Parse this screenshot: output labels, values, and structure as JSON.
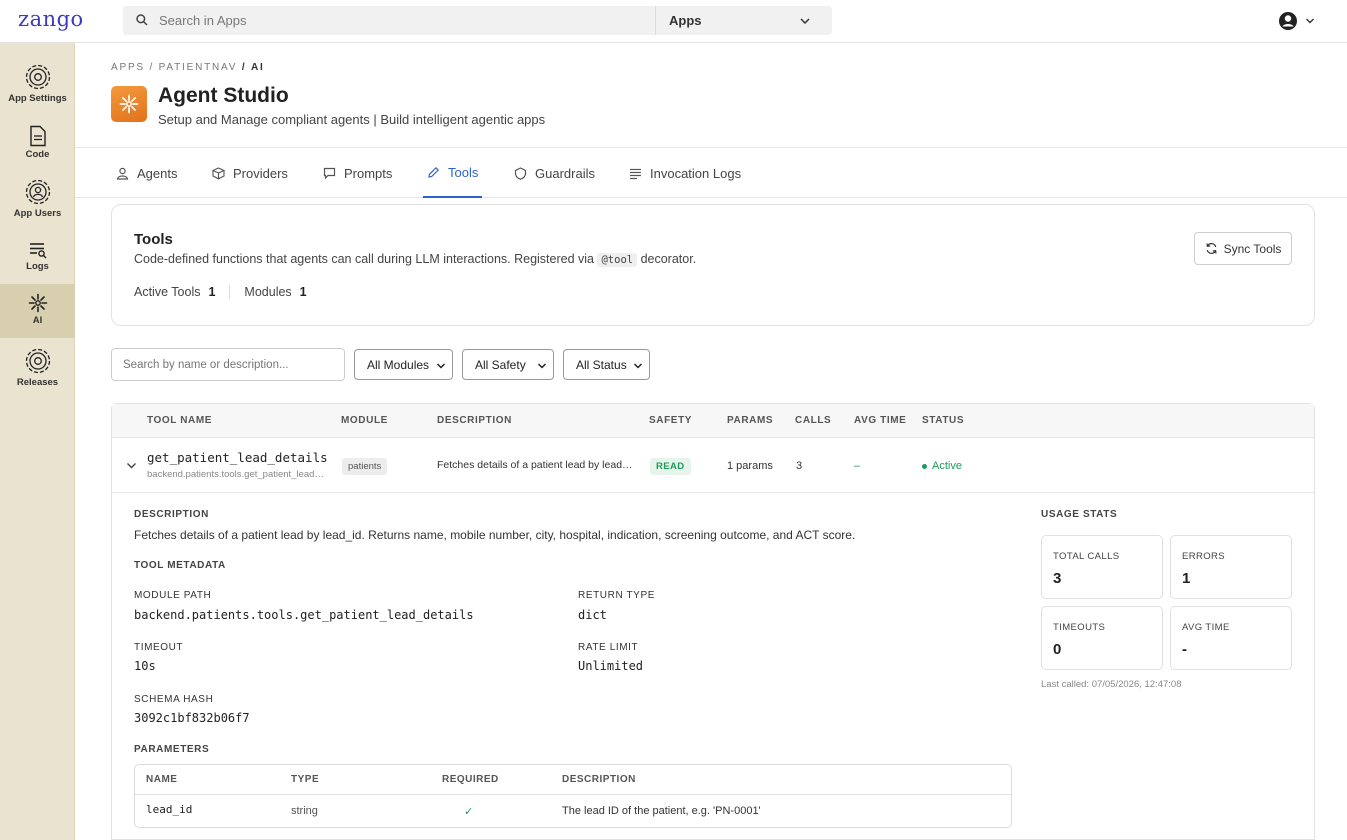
{
  "topbar": {
    "logo": "zango",
    "search_placeholder": "Search in Apps",
    "scope": "Apps"
  },
  "sidebar": {
    "items": [
      {
        "label": "App Settings",
        "icon": "gear-icon"
      },
      {
        "label": "Code",
        "icon": "file-icon"
      },
      {
        "label": "App Users",
        "icon": "users-gear-icon"
      },
      {
        "label": "Logs",
        "icon": "logs-icon"
      },
      {
        "label": "AI",
        "icon": "ai-sparkle-icon"
      },
      {
        "label": "Releases",
        "icon": "gear-icon"
      }
    ],
    "active": "AI",
    "active_color": "#d8cfae"
  },
  "breadcrumb": {
    "part1": "APPS",
    "sep": "/",
    "part2": "PATIENTNAV",
    "part3": "AI"
  },
  "header": {
    "title": "Agent Studio",
    "subtitle": "Setup and Manage compliant agents | Build intelligent agentic apps",
    "icon_color": "#e97b25"
  },
  "tabs": [
    {
      "label": "Agents",
      "icon": "person-icon"
    },
    {
      "label": "Providers",
      "icon": "cube-icon"
    },
    {
      "label": "Prompts",
      "icon": "message-icon"
    },
    {
      "label": "Tools",
      "icon": "pencil-icon"
    },
    {
      "label": "Guardrails",
      "icon": "shield-icon"
    },
    {
      "label": "Invocation Logs",
      "icon": "list-icon"
    }
  ],
  "active_tab": "Tools",
  "accent_color": "#2d63c8",
  "tools_card": {
    "title": "Tools",
    "desc_before": "Code-defined functions that agents can call during LLM interactions. Registered via",
    "desc_code": "@tool",
    "desc_after": "decorator.",
    "active_label": "Active Tools",
    "active_value": "1",
    "modules_label": "Modules",
    "modules_value": "1",
    "sync_label": "Sync Tools"
  },
  "filters": {
    "search_placeholder": "Search by name or description...",
    "modules": "All Modules",
    "safety": "All Safety",
    "status": "All Status"
  },
  "table": {
    "columns": [
      "TOOL NAME",
      "MODULE",
      "DESCRIPTION",
      "SAFETY",
      "PARAMS",
      "CALLS",
      "AVG TIME",
      "STATUS"
    ],
    "row": {
      "name": "get_patient_lead_details",
      "path": "backend.patients.tools.get_patient_lead_details",
      "module": "patients",
      "description": "Fetches details of a patient lead by lead_id. Returns name, mobile number, city, hospital, indication, screening outcome, and ACT score.",
      "safety": "READ",
      "params": "1 params",
      "calls": "3",
      "avg_time": "–",
      "status": "Active",
      "status_color": "#1f9a5a"
    }
  },
  "details": {
    "description_label": "DESCRIPTION",
    "description": "Fetches details of a patient lead by lead_id. Returns name, mobile number, city, hospital, indication, screening outcome, and ACT score.",
    "metadata_label": "TOOL METADATA",
    "module_path_label": "MODULE PATH",
    "module_path": "backend.patients.tools.get_patient_lead_details",
    "return_type_label": "RETURN TYPE",
    "return_type": "dict",
    "timeout_label": "TIMEOUT",
    "timeout": "10s",
    "rate_limit_label": "RATE LIMIT",
    "rate_limit": "Unlimited",
    "schema_hash_label": "SCHEMA HASH",
    "schema_hash": "3092c1bf832b06f7",
    "parameters_label": "PARAMETERS",
    "param_columns": [
      "NAME",
      "TYPE",
      "REQUIRED",
      "DESCRIPTION"
    ],
    "param": {
      "name": "lead_id",
      "type": "string",
      "required": "✓",
      "description": "The lead ID of the patient, e.g. 'PN-0001'"
    }
  },
  "usage": {
    "label": "USAGE STATS",
    "total_calls_label": "TOTAL CALLS",
    "total_calls": "3",
    "errors_label": "ERRORS",
    "errors": "1",
    "timeouts_label": "TIMEOUTS",
    "timeouts": "0",
    "avg_time_label": "AVG TIME",
    "avg_time": "-",
    "last_called": "Last called: 07/05/2026, 12:47:08"
  }
}
